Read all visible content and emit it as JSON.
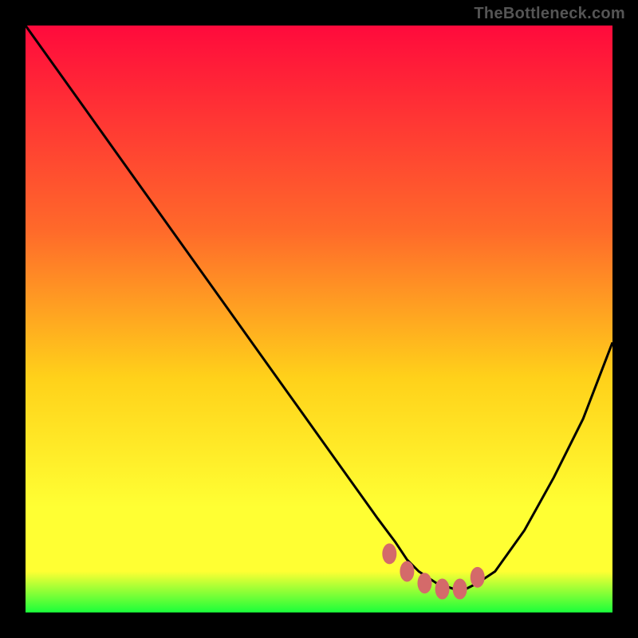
{
  "watermark": "TheBottleneck.com",
  "colors": {
    "bg": "#000000",
    "watermark": "#555555",
    "curve": "#000000",
    "marker": "#d46a6a",
    "gradient_top": "#ff0a3c",
    "gradient_mid1": "#ff6a2a",
    "gradient_mid2": "#ffd11a",
    "gradient_mid3": "#ffff33",
    "gradient_bottom": "#1aff3a"
  },
  "chart_data": {
    "type": "line",
    "title": "",
    "xlabel": "",
    "ylabel": "",
    "xlim": [
      0,
      100
    ],
    "ylim": [
      0,
      100
    ],
    "grid": false,
    "series": [
      {
        "name": "bottleneck-curve",
        "x": [
          0,
          5,
          10,
          15,
          20,
          25,
          30,
          35,
          40,
          45,
          50,
          55,
          60,
          63,
          65,
          67,
          70,
          73,
          75,
          77,
          80,
          85,
          90,
          95,
          100
        ],
        "values": [
          100,
          93,
          86,
          79,
          72,
          65,
          58,
          51,
          44,
          37,
          30,
          23,
          16,
          12,
          9,
          7,
          5,
          4,
          4,
          5,
          7,
          14,
          23,
          33,
          46
        ]
      }
    ],
    "markers": {
      "name": "optimal-range",
      "x": [
        62,
        65,
        68,
        71,
        74,
        77
      ],
      "values": [
        10,
        7,
        5,
        4,
        4,
        6
      ]
    }
  }
}
